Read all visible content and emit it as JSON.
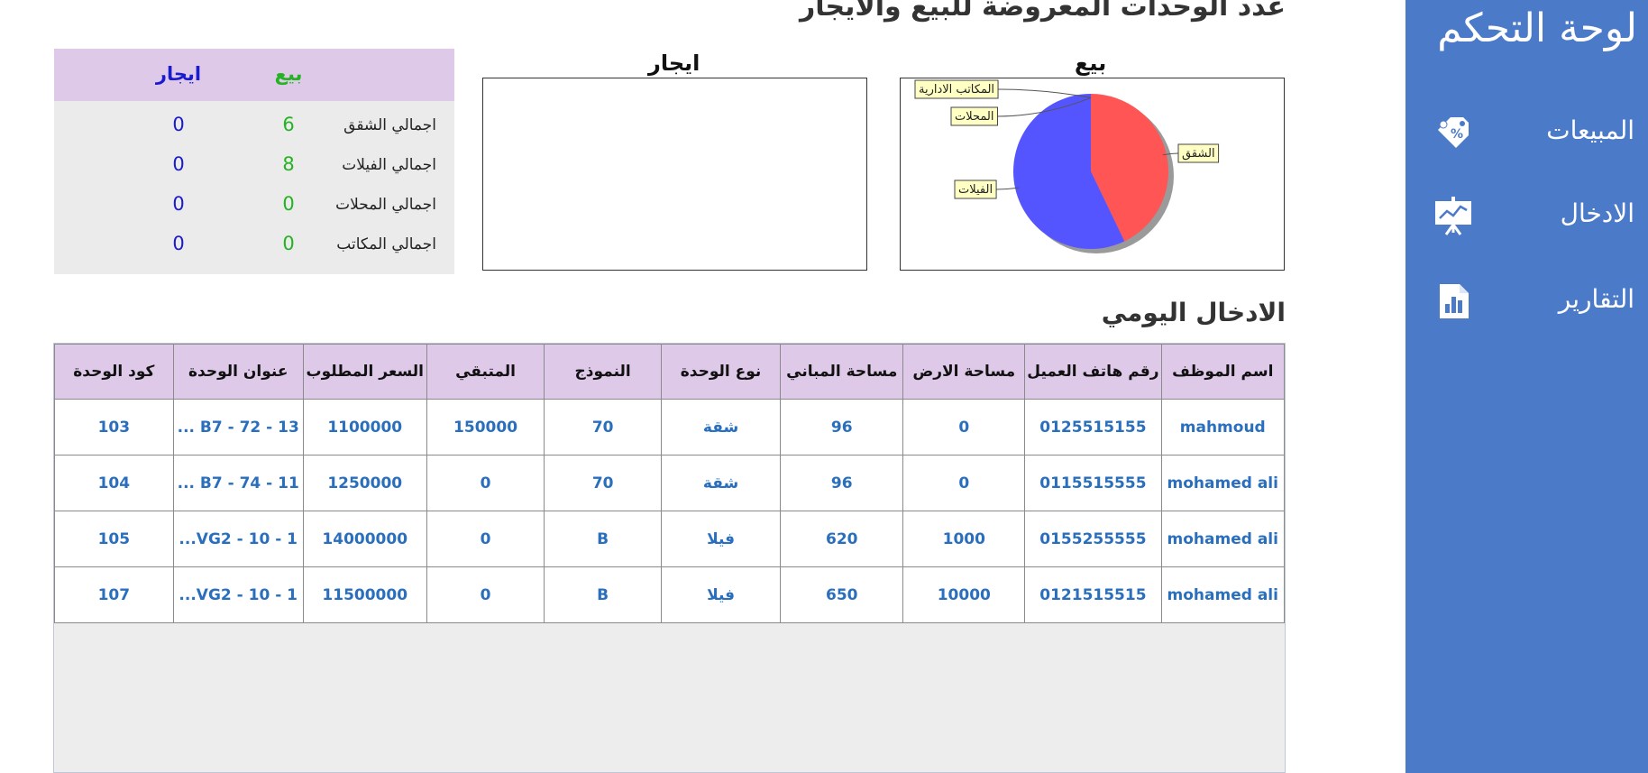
{
  "sidebar": {
    "title": "لوحة التحكم",
    "items": [
      {
        "label": "المبيعات",
        "icon": "sales-tag-icon"
      },
      {
        "label": "الادخال",
        "icon": "presentation-chart-icon"
      },
      {
        "label": "التقارير",
        "icon": "bar-report-icon"
      }
    ]
  },
  "main": {
    "title": "عدد الوحدات المعروضة للبيع والايجار",
    "daily_title": "الادخال اليومي"
  },
  "charts": {
    "sale_title": "بيع",
    "rent_title": "ايجار"
  },
  "chart_data": {
    "type": "pie",
    "title": "بيع",
    "labels": [
      "الشقق",
      "الفيلات",
      "المحلات",
      "المكاتب الادارية"
    ],
    "values": [
      6,
      8,
      0,
      0
    ],
    "colors": [
      "#ff5555",
      "#5555ff",
      "#55ff55",
      "#ffff55"
    ]
  },
  "summary": {
    "col_sale": "بيع",
    "col_rent": "ايجار",
    "rows": [
      {
        "label": "اجمالي الشقق",
        "sale": "6",
        "rent": "0"
      },
      {
        "label": "اجمالي الفيلات",
        "sale": "8",
        "rent": "0"
      },
      {
        "label": "اجمالي المحلات",
        "sale": "0",
        "rent": "0"
      },
      {
        "label": "اجمالي المكاتب",
        "sale": "0",
        "rent": "0"
      }
    ]
  },
  "grid": {
    "headers": [
      "اسم الموظف",
      "رقم هاتف العميل",
      "مساحة الارض",
      "مساحة المباني",
      "نوع الوحدة",
      "النموذج",
      "المتبقي",
      "السعر المطلوب",
      "عنوان الوحدة",
      "كود الوحدة"
    ],
    "rows": [
      [
        "mahmoud",
        "0125515155",
        "0",
        "96",
        "شقة",
        "70",
        "150000",
        "1100000",
        "B7 - 72 - 13 ...",
        "103"
      ],
      [
        "mohamed ali",
        "0115515555",
        "0",
        "96",
        "شقة",
        "70",
        "0",
        "1250000",
        "B7 - 74 - 11 ...",
        "104"
      ],
      [
        "mohamed ali",
        "0155255555",
        "1000",
        "620",
        "فيلا",
        "B",
        "0",
        "14000000",
        "VG2 - 10 - 1...",
        "105"
      ],
      [
        "mohamed ali",
        "0121515515",
        "10000",
        "650",
        "فيلا",
        "B",
        "0",
        "11500000",
        "VG2 - 10 - 1...",
        "107"
      ]
    ]
  },
  "colors": {
    "sidebar": "#4a7ac8",
    "header_bg": "#dfc9e9",
    "sale_value": "#23b323",
    "rent_value": "#1a1ad0",
    "cell_text": "#2a6fbe"
  }
}
